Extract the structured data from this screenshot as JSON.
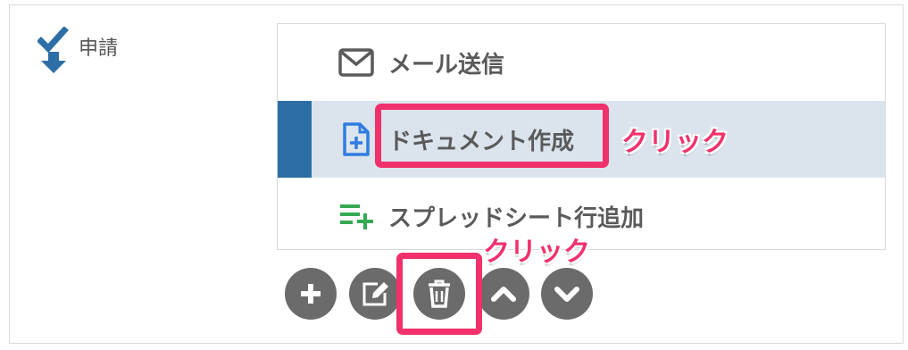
{
  "section": {
    "title": "申請",
    "icon": "check-down-arrow-icon"
  },
  "steps": [
    {
      "label": "メール送信",
      "icon": "envelope-icon",
      "selected": false
    },
    {
      "label": "ドキュメント作成",
      "icon": "document-add-icon",
      "selected": true
    },
    {
      "label": "スプレッドシート行追加",
      "icon": "list-add-icon",
      "selected": false
    }
  ],
  "annotations": {
    "click_step": "クリック",
    "click_delete": "クリック"
  },
  "controls": [
    "add-icon",
    "edit-icon",
    "trash-icon",
    "chevron-up-icon",
    "chevron-down-icon"
  ],
  "colors": {
    "selected_bar": "#2c6ea5",
    "selected_bg": "#dbe4ec",
    "highlight": "#f0316c",
    "control_bg": "#6b6b6b"
  }
}
